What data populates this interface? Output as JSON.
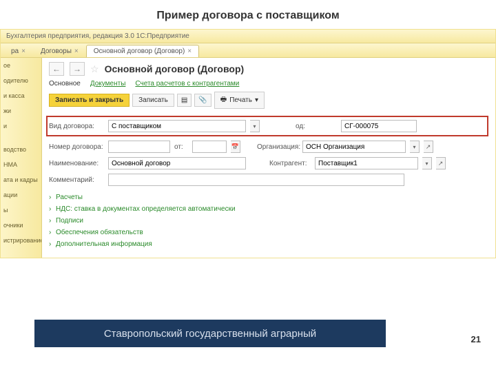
{
  "slide_title": "Пример договора с поставщиком",
  "titlebar": "Бухгалтерия предприятия, редакция 3.0 1С:Предприятие",
  "tabs": [
    {
      "label": "ра",
      "active": false
    },
    {
      "label": "Договоры",
      "active": false
    },
    {
      "label": "Основной договор (Договор)",
      "active": true
    }
  ],
  "sidebar": {
    "items": [
      "ое",
      "одителю",
      "и касса",
      "жи",
      "и",
      "",
      "водство",
      "НМА",
      "ата и кадры",
      "ации",
      "ы",
      "очники",
      "истрирование"
    ]
  },
  "doc": {
    "nav_back": "←",
    "nav_fwd": "→",
    "star": "☆",
    "title": "Основной договор (Договор)"
  },
  "subnav": {
    "main": "Основное",
    "docs": "Документы",
    "accounts": "Счета расчетов с контрагентами"
  },
  "toolbar": {
    "save_close": "Записать и закрыть",
    "save": "Записать",
    "print": "Печать"
  },
  "form": {
    "contract_type_label": "Вид договора:",
    "contract_type_value": "С поставщиком",
    "code_label": "од:",
    "code_value": "СГ-000075",
    "number_label": "Номер договора:",
    "number_value": "",
    "from_label": "от:",
    "from_value": "",
    "org_label": "Организация:",
    "org_value": "ОСН Организация",
    "name_label": "Наименование:",
    "name_value": "Основной договор",
    "counter_label": "Контрагент:",
    "counter_value": "Поставщик1",
    "comment_label": "Комментарий:",
    "comment_value": ""
  },
  "expand": [
    "Расчеты",
    "НДС: ставка в документах определяется автоматически",
    "Подписи",
    "Обеспечения обязательств",
    "Дополнительная информация"
  ],
  "footer_text": "Ставропольский государственный аграрный",
  "page_number": "21"
}
